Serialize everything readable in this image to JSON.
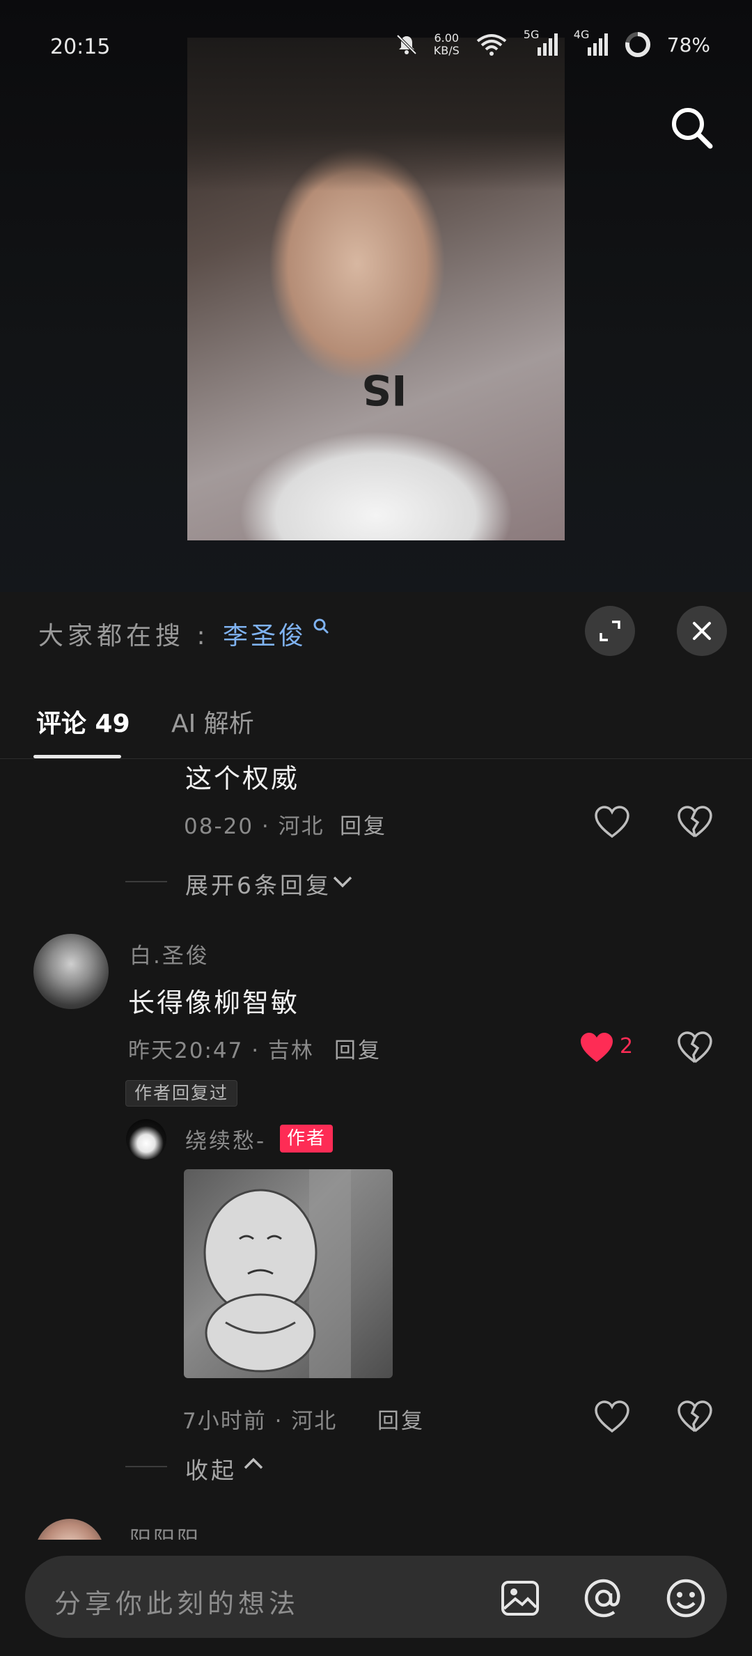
{
  "status_bar": {
    "time": "20:15",
    "net_speed_value": "6.00",
    "net_speed_unit": "KB/S",
    "signal_1": "5G",
    "signal_2": "4G",
    "battery": "78%"
  },
  "trending": {
    "label": "大家都在搜 :",
    "term": "李圣俊"
  },
  "tabs": [
    {
      "label": "评论 49"
    },
    {
      "label": "AI 解析"
    }
  ],
  "comments": {
    "partial": {
      "text": "这个权威",
      "meta": "08-20 · 河北",
      "reply": "回复"
    },
    "expand": {
      "label": "展开6条回复"
    },
    "main": {
      "username": "白.圣俊",
      "text": "长得像柳智敏",
      "meta": "昨天20:47 · 吉林",
      "reply": "回复",
      "likes": "2",
      "badge": "作者回复过"
    },
    "author_reply": {
      "username": "绕续愁-",
      "tag": "作者",
      "meta": "7小时前 · 河北",
      "reply": "回复"
    },
    "collapse": {
      "label": "收起"
    },
    "next": {
      "username": "阳阳阳"
    }
  },
  "input": {
    "placeholder": "分享你此刻的想法"
  },
  "colors": {
    "like_red": "#fe2c55",
    "link_blue": "#7fb2f0",
    "background": "#161616"
  },
  "icons": [
    "search-icon",
    "expand-icon",
    "close-icon",
    "heart-icon",
    "broken-heart-icon",
    "chevron-down-icon",
    "chevron-up-icon",
    "image-icon",
    "at-icon",
    "emoji-icon"
  ]
}
